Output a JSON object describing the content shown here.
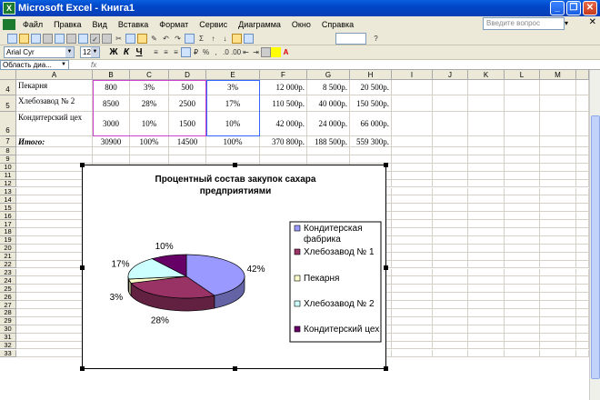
{
  "window": {
    "title": "Microsoft Excel - Книга1",
    "app_icon": "excel-icon"
  },
  "menu": [
    "Файл",
    "Правка",
    "Вид",
    "Вставка",
    "Формат",
    "Сервис",
    "Диаграмма",
    "Окно",
    "Справка"
  ],
  "help_placeholder": "Введите вопрос",
  "format": {
    "font": "Arial Cyr",
    "size": "12",
    "bold": "Ж",
    "italic": "К",
    "underline": "Ч"
  },
  "namebox": "Область диа...",
  "fx": "fx",
  "columns": [
    "A",
    "B",
    "C",
    "D",
    "E",
    "F",
    "G",
    "H",
    "I",
    "J",
    "K",
    "L",
    "M"
  ],
  "rows": [
    {
      "num": "4",
      "cells": [
        "Пекарня",
        "800",
        "3%",
        "500",
        "3%",
        "12 000р.",
        "8 500р.",
        "20 500р."
      ]
    },
    {
      "num": "5",
      "cells": [
        "Хлебозавод № 2",
        "8500",
        "28%",
        "2500",
        "17%",
        "110 500р.",
        "40 000р.",
        "150 500р."
      ]
    },
    {
      "num": "6",
      "cells": [
        "Кондитерский цех",
        "3000",
        "10%",
        "1500",
        "10%",
        "42 000р.",
        "24 000р.",
        "66 000р."
      ]
    },
    {
      "num": "7",
      "cells": [
        "Итого:",
        "30900",
        "100%",
        "14500",
        "100%",
        "370 800р.",
        "188 500р.",
        "559 300р."
      ]
    }
  ],
  "empty_rows": [
    "8",
    "9",
    "10",
    "11",
    "12",
    "13",
    "14",
    "15",
    "16",
    "17",
    "18",
    "19",
    "20",
    "21",
    "22",
    "23",
    "24",
    "25",
    "26",
    "27",
    "28",
    "29",
    "30",
    "31",
    "32",
    "33"
  ],
  "chart_data": {
    "type": "pie",
    "title": "Процентный состав закупок  сахара предприятиями",
    "categories": [
      "Кондитерская фабрика",
      "Хлебозавод № 1",
      "Пекарня",
      "Хлебозавод № 2",
      "Кондитерский цех"
    ],
    "values": [
      42,
      28,
      3,
      17,
      10
    ],
    "labels": [
      "42%",
      "28%",
      "3%",
      "17%",
      "10%"
    ],
    "colors": [
      "#9999ff",
      "#993366",
      "#ffffcc",
      "#ccffff",
      "#660066"
    ],
    "legend": "right"
  }
}
